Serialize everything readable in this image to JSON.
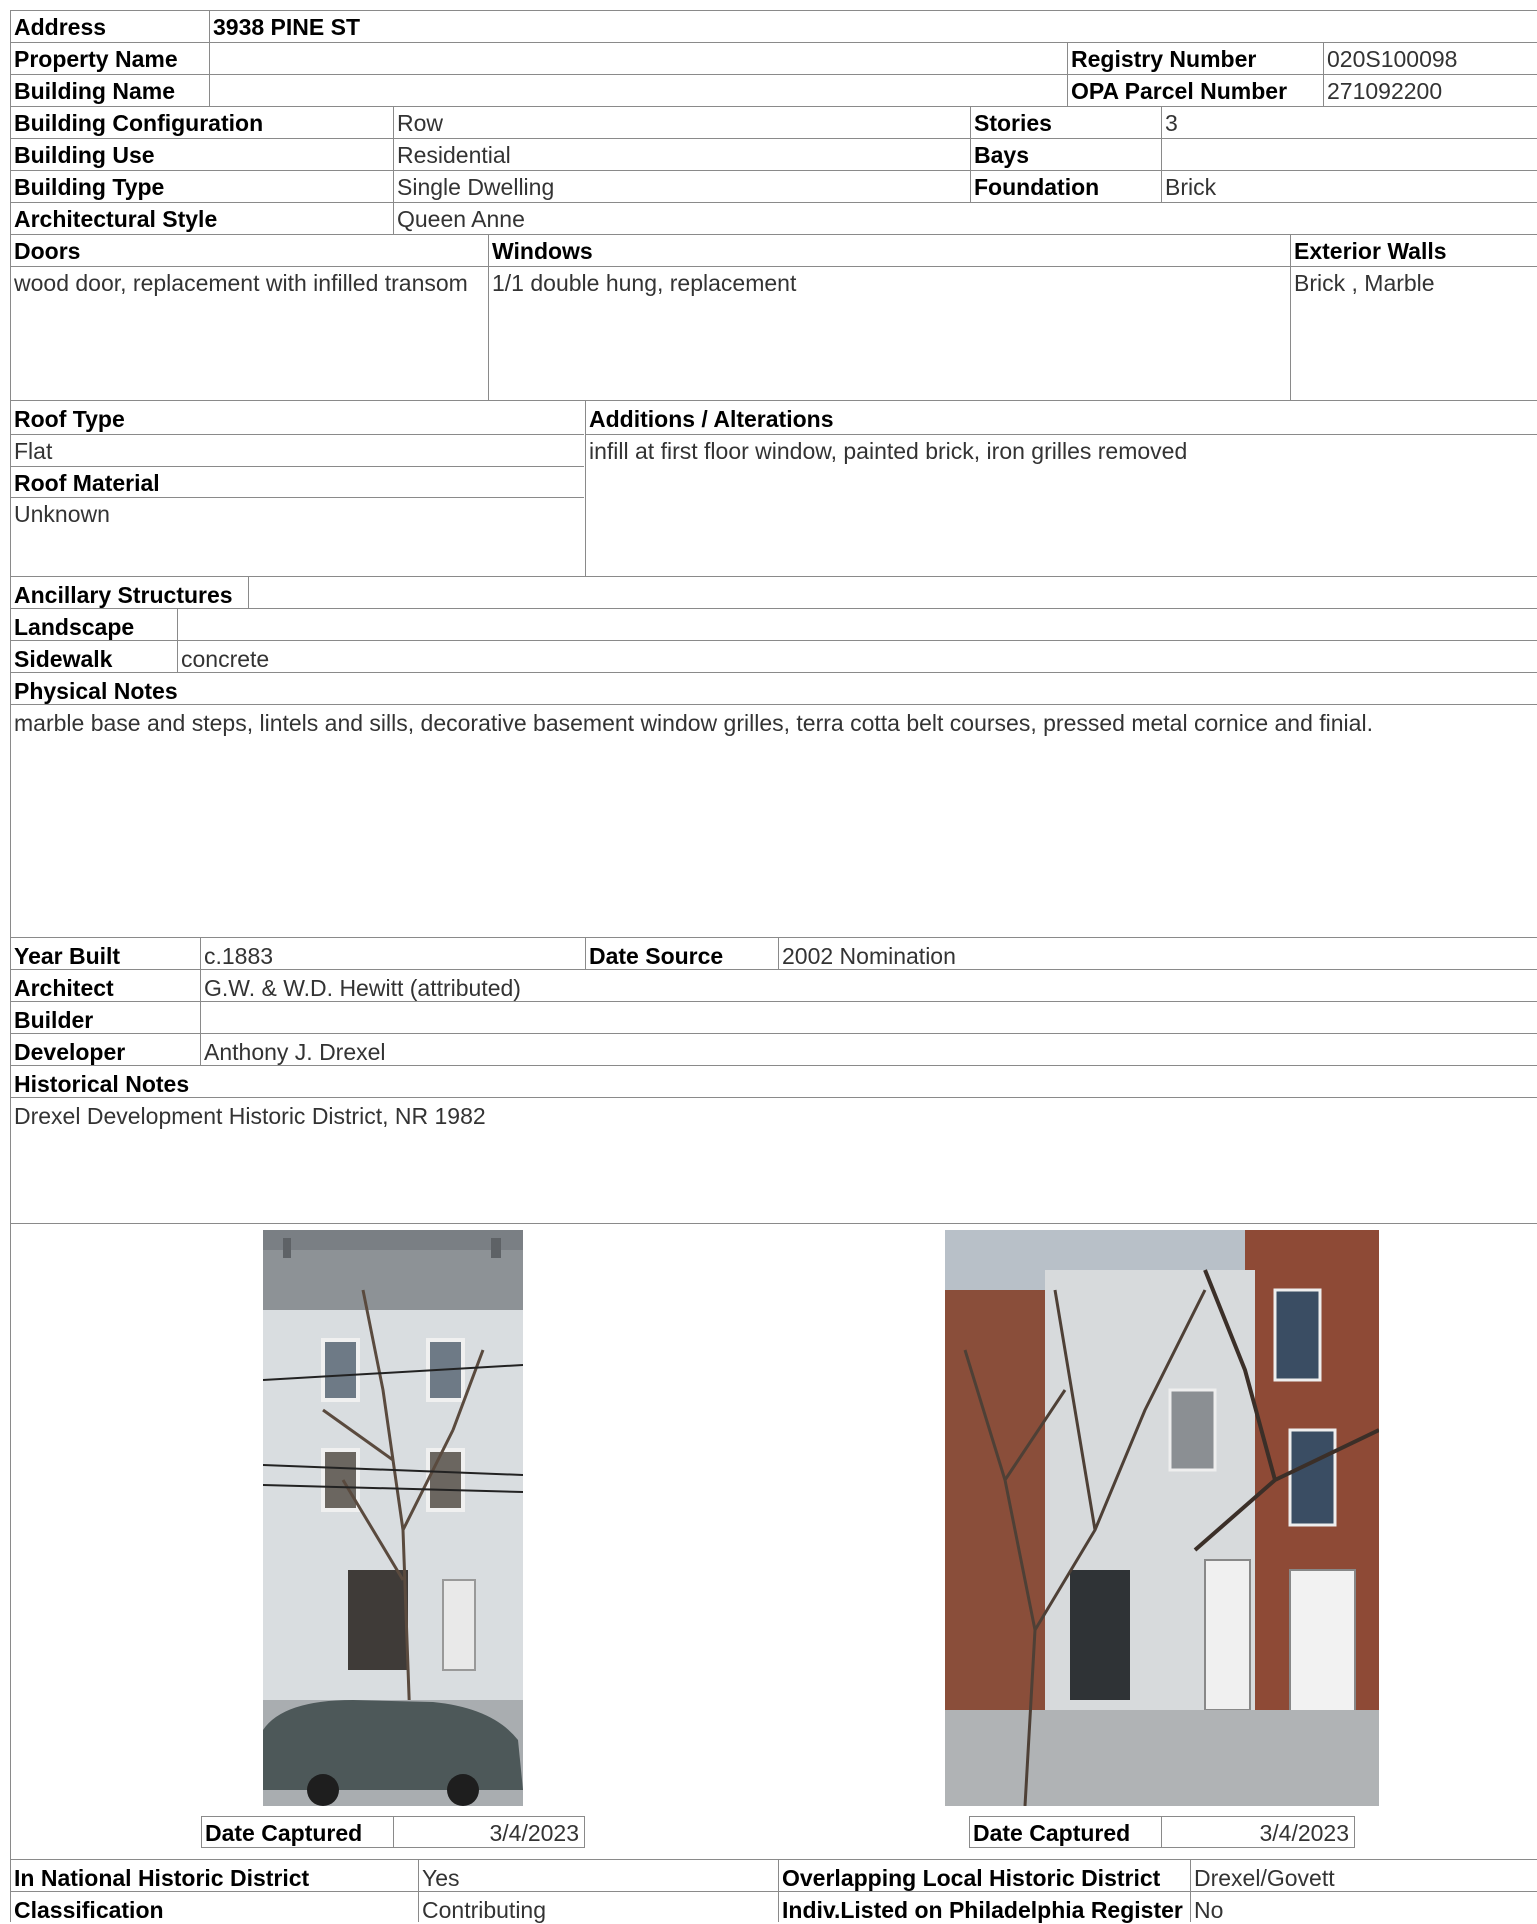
{
  "address": {
    "label": "Address",
    "value": "3938 PINE ST"
  },
  "property_name": {
    "label": "Property Name",
    "value": ""
  },
  "registry_number": {
    "label": "Registry Number",
    "value": "020S100098"
  },
  "building_name": {
    "label": "Building Name",
    "value": ""
  },
  "opa_parcel_number": {
    "label": "OPA Parcel Number",
    "value": "271092200"
  },
  "building_configuration": {
    "label": "Building Configuration",
    "value": "Row"
  },
  "stories": {
    "label": "Stories",
    "value": "3"
  },
  "building_use": {
    "label": "Building Use",
    "value": "Residential"
  },
  "bays": {
    "label": "Bays",
    "value": ""
  },
  "building_type": {
    "label": "Building Type",
    "value": "Single Dwelling"
  },
  "foundation": {
    "label": "Foundation",
    "value": "Brick"
  },
  "architectural_style": {
    "label": "Architectural Style",
    "value": "Queen Anne"
  },
  "doors": {
    "label": "Doors",
    "value": "wood door, replacement with infilled transom"
  },
  "windows": {
    "label": "Windows",
    "value": "1/1 double hung, replacement"
  },
  "exterior_walls": {
    "label": "Exterior Walls",
    "value": "Brick , Marble"
  },
  "roof_type": {
    "label": "Roof Type",
    "value": "Flat"
  },
  "roof_material": {
    "label": "Roof Material",
    "value": "Unknown"
  },
  "additions_alterations": {
    "label": "Additions / Alterations",
    "value": "infill at first floor window, painted brick, iron grilles removed"
  },
  "ancillary_structures": {
    "label": "Ancillary Structures",
    "value": ""
  },
  "landscape": {
    "label": "Landscape",
    "value": ""
  },
  "sidewalk": {
    "label": "Sidewalk",
    "value": "concrete"
  },
  "physical_notes": {
    "label": "Physical Notes",
    "value": "marble base and steps, lintels and sills, decorative basement window grilles, terra cotta belt courses, pressed metal cornice and finial."
  },
  "year_built": {
    "label": "Year Built",
    "value": "c.1883"
  },
  "date_source": {
    "label": "Date Source",
    "value": "2002 Nomination"
  },
  "architect": {
    "label": "Architect",
    "value": "G.W. & W.D. Hewitt (attributed)"
  },
  "builder": {
    "label": "Builder",
    "value": ""
  },
  "developer": {
    "label": "Developer",
    "value": "Anthony J. Drexel"
  },
  "historical_notes": {
    "label": "Historical Notes",
    "value": "Drexel Development Historic District, NR 1982"
  },
  "photos": [
    {
      "date_label": "Date Captured",
      "date_value": "3/4/2023"
    },
    {
      "date_label": "Date Captured",
      "date_value": "3/4/2023"
    }
  ],
  "national_historic_district": {
    "label": "In National Historic District",
    "value": "Yes"
  },
  "overlapping_local_district": {
    "label": "Overlapping Local Historic District",
    "value": "Drexel/Govett"
  },
  "classification": {
    "label": "Classification",
    "value": "Contributing"
  },
  "indiv_listed": {
    "label": "Indiv.Listed on Philadelphia Register",
    "value": "No"
  }
}
